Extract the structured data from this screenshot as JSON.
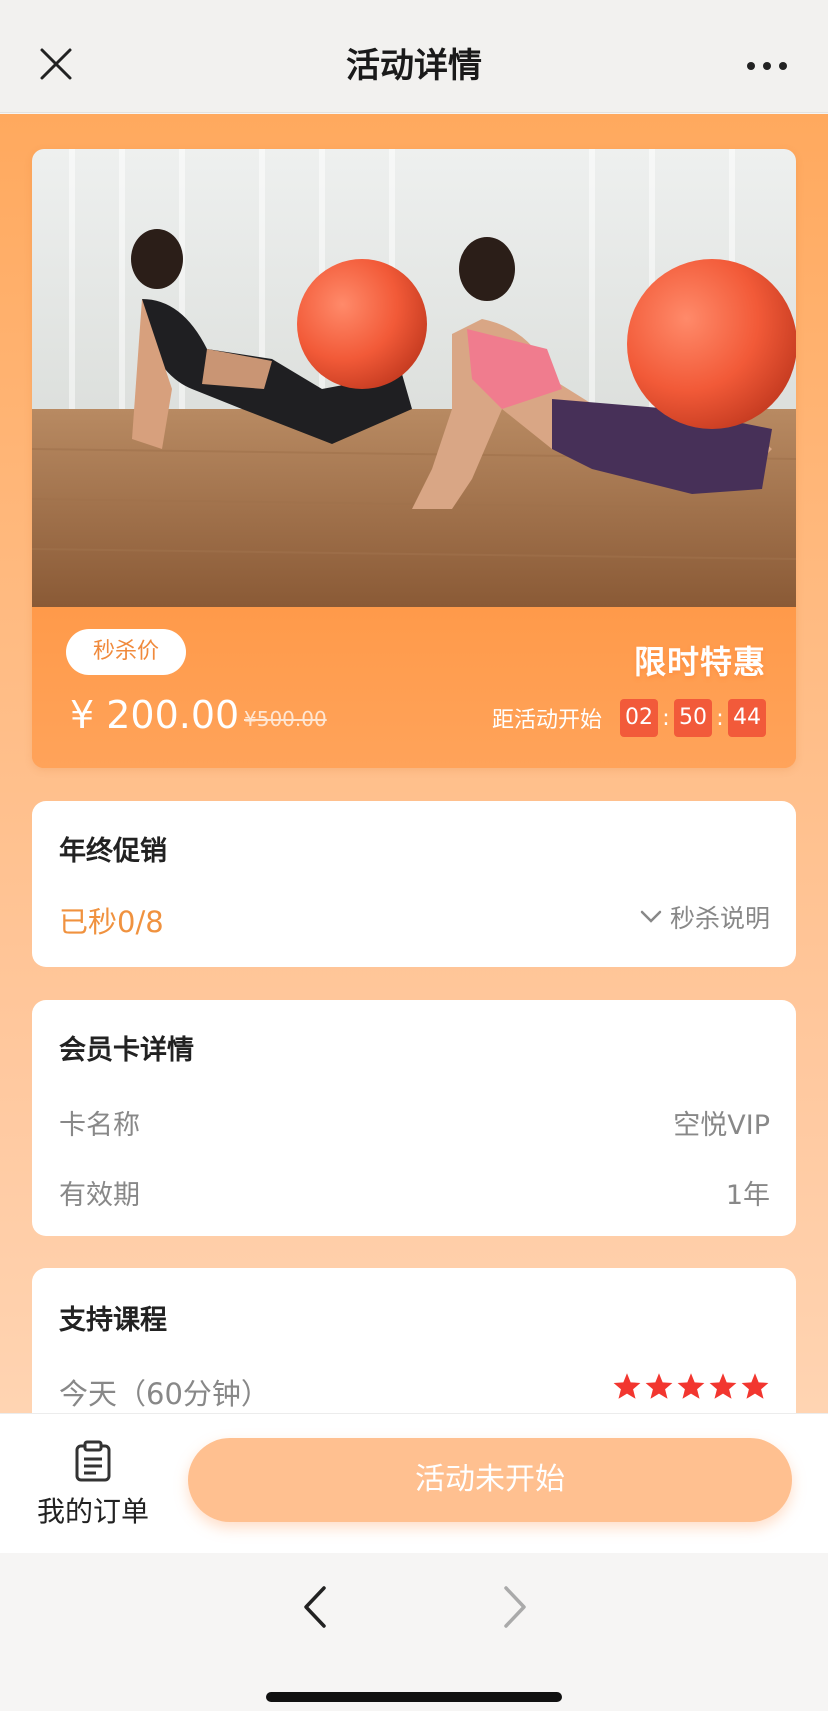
{
  "header": {
    "title": "活动详情"
  },
  "hero": {
    "sale_tag": "秒杀价",
    "limited_label": "限时特惠",
    "price": "¥ 200.00",
    "original_price": "¥500.00",
    "countdown_label": "距活动开始",
    "countdown": {
      "h": "02",
      "m": "50",
      "s": "44"
    },
    "photo_icon": "yoga-ball-photo"
  },
  "promo": {
    "title": "年终促销",
    "sold": "已秒0/8",
    "rules_label": "秒杀说明"
  },
  "card_details": {
    "title": "会员卡详情",
    "rows": [
      {
        "label": "卡名称",
        "value": "空悦VIP"
      },
      {
        "label": "有效期",
        "value": "1年"
      }
    ]
  },
  "courses": {
    "title": "支持课程",
    "items": [
      {
        "name": "今天（60分钟）",
        "rating": 5
      }
    ]
  },
  "action_bar": {
    "orders_label": "我的订单",
    "cta_label": "活动未开始"
  },
  "colors": {
    "accent": "#f0923f",
    "countdown_box": "#f25a3a",
    "star": "#f2362f",
    "cta_disabled": "#ffc090"
  }
}
